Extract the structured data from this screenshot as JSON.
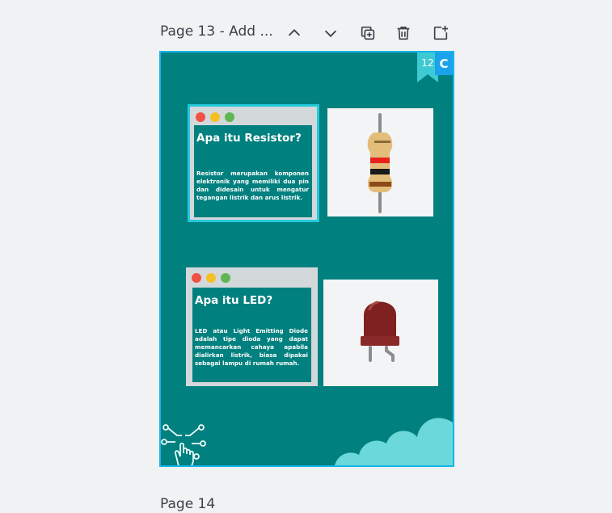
{
  "header": {
    "page_title": "Page 13 - Add ...",
    "icons": [
      "chevron-up-icon",
      "chevron-down-icon",
      "duplicate-icon",
      "trash-icon",
      "add-page-icon"
    ]
  },
  "slide": {
    "comment_count": "12",
    "avatar_initial": "C",
    "colors": {
      "background": "#00807e",
      "selection": "#18b4e9",
      "cloud": "#6bd8d9"
    },
    "card1": {
      "title": "Apa itu Resistor?",
      "body": "Resistor merupakan komponen elektronik yang memiliki dua pin dan didesain untuk mengatur tegangan listrik dan arus listrik."
    },
    "card2": {
      "title": "Apa itu LED?",
      "body": "LED atau Light Emitting Diode adalah tipe dioda yang dapat memancarkan cahaya apabila dialirkan listrik, biasa dipakai sebagai lampu di rumah rumah."
    }
  },
  "next_page": {
    "title": "Page 14"
  }
}
